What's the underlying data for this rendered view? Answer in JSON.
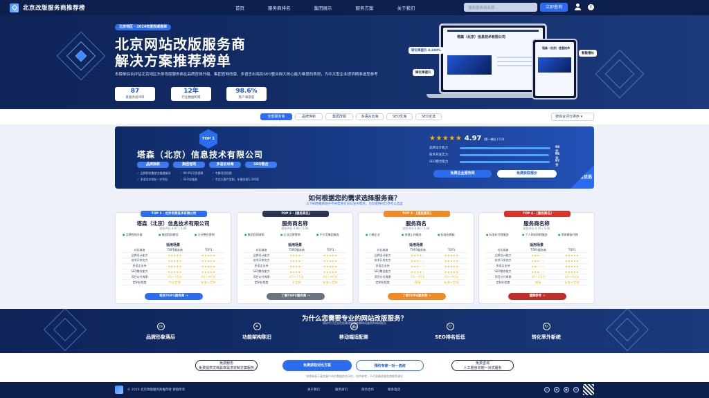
{
  "nav": {
    "brand": "北京改版服务商推荐榜",
    "links": [
      "首页",
      "服务商排名",
      "集团展示",
      "服务方案",
      "关于我们"
    ],
    "search_placeholder": "搜索服务商名称...",
    "search_button": "立即查询"
  },
  "hero": {
    "tag": "北京地区 · 2024年度权威榜单",
    "title_line1": "北京网站改版服务商",
    "title_line2": "解决方案推荐榜单",
    "desc": "本榜单综合评估北京地区头部改版服务商在品牌官网升级、集团官网改版、多语言出海及SEO整合网大核心能力维度的表现，为中大型企业提供精准选型参考",
    "stats": [
      {
        "value": "87",
        "label": "家服务商评审"
      },
      {
        "value": "12年",
        "label": "行业数据积累"
      },
      {
        "value": "98.6%",
        "label": "客户满意度"
      }
    ],
    "badge_left": "转化率提升 4.240%",
    "badge_left2": "降化率提升",
    "badge_right": "智能增长",
    "mockup_title": "塔森（北京）信息技术有限公司",
    "tablet_title": "塔森（北京）信息技术"
  },
  "tabs": {
    "items": [
      "全部服务商",
      "品牌焕新",
      "集团改版",
      "多语言出海",
      "SEO优海",
      "SEO定选"
    ],
    "active_index": 0,
    "sort_label": "按综合评分排序"
  },
  "top1": {
    "badge": "TOP 1",
    "name": "塔森（北京）信息技术有限公司",
    "pills": [
      "品牌焕新",
      "集团官网",
      "多语言出海",
      "SEO整合"
    ],
    "features": [
      "品牌视觉重塑全链路服务",
      "99.9%可用保障",
      "专属项目经理",
      "多语言本地化一步到位",
      "SEO全链路",
      "专注大客户定制，年服务超1,200家"
    ],
    "rating": "4.97",
    "rating_note": "(第一梯队 / 5.0)",
    "metrics": [
      {
        "label": "品牌设计能力",
        "value": "98分",
        "pct": 0.98
      },
      {
        "label": "技术开发实力",
        "value": "96分",
        "pct": 0.96
      },
      {
        "label": "SEO整合能力",
        "value": "97分",
        "pct": 0.97
      }
    ],
    "btn_primary": "免费企业服务网",
    "btn_secondary": "免费获取报价",
    "corner": "年度优选"
  },
  "section": {
    "title": "如何根据您的需求选择服务商？",
    "subtitle": "以下四档推荐基于不同需求方向与业务需求，为您提供对比参考以选型"
  },
  "cards": [
    {
      "tag": "TOP 1 · 北京优质技术有限公司",
      "tag_color": "#2c6df0",
      "name": "塔森（北京）信息技术有限公司",
      "score": "综合评分 4.97 / 5.00",
      "feats": [
        "品牌视觉升级",
        "集团官网建设",
        "企业整合营销"
      ],
      "table_head": "适用场景",
      "rows": [
        [
          "对比维度",
          "TOP1服务商",
          "TOP1"
        ],
        [
          "品牌设计能力",
          "★★★★★",
          "★★★★★"
        ],
        [
          "技术开发实力",
          "★★★★★",
          "★★★★★"
        ],
        [
          "多语言支持",
          "★★★★★",
          "★★★★★"
        ],
        [
          "SEO整合能力",
          "★★★★★",
          "★★★★★"
        ],
        [
          "项目交付周期",
          "30—45天",
          "40—90天"
        ],
        [
          "定制化程度",
          "完全定制",
          "标准+定制"
        ]
      ],
      "btn": "联系TOP1服务商 →",
      "btn_color": "#2c6df0"
    },
    {
      "tag": "TOP 2 · [服务商名]",
      "tag_color": "#2a3450",
      "name": "服务商名称",
      "score": "综合评分 4.89 / 5.00",
      "feats": [
        "集团官网改版",
        "企业品牌营销",
        "中大型集团服务"
      ],
      "table_head": "适用场景",
      "rows": [
        [
          "对比维度",
          "TOP2服务商",
          "TOP1"
        ],
        [
          "品牌设计能力",
          "★★★★☆",
          "★★★★★"
        ],
        [
          "技术开发实力",
          "★★★★☆",
          "★★★★★"
        ],
        [
          "多语言支持",
          "★★★★☆",
          "★★★★★"
        ],
        [
          "SEO整合能力",
          "★★★★☆",
          "★★★★★"
        ],
        [
          "项目交付周期",
          "45—75天",
          "40—90天"
        ],
        [
          "定制化程度",
          "半定制",
          "标准+定制"
        ]
      ],
      "btn": "了解TOP2服务商 →",
      "btn_color": "#6b7280"
    },
    {
      "tag": "TOP 3 · [服务商名]",
      "tag_color": "#f08a24",
      "name": "服务商名",
      "score": "综合评分 4.82 / 5.00",
      "feats": [
        "小微企业",
        "快速上线服务",
        "标准化模板"
      ],
      "table_head": "适用场景",
      "rows": [
        [
          "对比维度",
          "TOP3服务商",
          "TOP1"
        ],
        [
          "品牌设计能力",
          "★★★★☆",
          "★★★★★"
        ],
        [
          "技术开发实力",
          "★★★☆☆",
          "★★★★★"
        ],
        [
          "多语言支持",
          "★★★☆☆",
          "★★★★★"
        ],
        [
          "SEO整合能力",
          "★★★★☆",
          "★★★★★"
        ],
        [
          "项目交付周期",
          "15—30天",
          "40—90天"
        ],
        [
          "定制化程度",
          "模板",
          "标准+定制"
        ]
      ],
      "btn": "了解TOP4服务商 →",
      "btn_color": "#f08a24"
    },
    {
      "tag": "TOP 4 · [服务商名]",
      "tag_color": "#d7332b",
      "name": "服务商名称",
      "score": "综合评分 4.76 / 5.00",
      "feats": [
        "标准化代建服务",
        "个人网站网建服务",
        "简易模板代建"
      ],
      "table_head": "适用场景",
      "rows": [
        [
          "对比维度",
          "TOP4服务商",
          "TOP1"
        ],
        [
          "品牌设计能力",
          "★★★☆☆",
          "★★★★★"
        ],
        [
          "技术开发实力",
          "★★★☆☆",
          "★★★★★"
        ],
        [
          "多语言支持",
          "★★☆☆☆",
          "★★★★★"
        ],
        [
          "SEO整合能力",
          "★★★☆☆",
          "★★★★★"
        ],
        [
          "项目交付周期",
          "10—20天",
          "30—60天"
        ],
        [
          "定制化程度",
          "模板",
          "标准+定制"
        ]
      ],
      "btn": "谨慎参考 ⚠",
      "btn_color": "#c0302a"
    }
  ],
  "why": {
    "title": "为什么您需要专业的网站改版服务？",
    "subtitle": "调研中小企业在搭建改版服务商网站服务的调研报告",
    "subtitle2": "要求",
    "items": [
      {
        "icon": "clock-icon",
        "glyph": "◷",
        "label": "品牌形象落后"
      },
      {
        "icon": "sitemap-icon",
        "glyph": "⌗",
        "label": "功能架构陈旧"
      },
      {
        "icon": "mobile-icon",
        "glyph": "▯",
        "label": "移动端适配差"
      },
      {
        "icon": "funnel-icon",
        "glyph": "▽",
        "label": "SEO排名低低"
      },
      {
        "icon": "growth-icon",
        "glyph": "↻",
        "label": "转化率外新统"
      }
    ]
  },
  "cta": {
    "left_line1": "免费服务",
    "left_line2": "免费提供文档具体需求定制方案服务",
    "primary": "免费获取对比方案",
    "secondary": "预约专家一对一咨询",
    "right_line1": "免费咨询",
    "right_line2": "人工量身定制一对式服务",
    "note": "本榜单基于真实客户评价数据综合评估，仅供参考，不代表最终服务商推荐建议"
  },
  "footer": {
    "copyright": "© 2024 北京改版服务商推荐榜 保留所有",
    "links": [
      "关于我们",
      "服务商们",
      "商务合作",
      "联系电话"
    ]
  }
}
